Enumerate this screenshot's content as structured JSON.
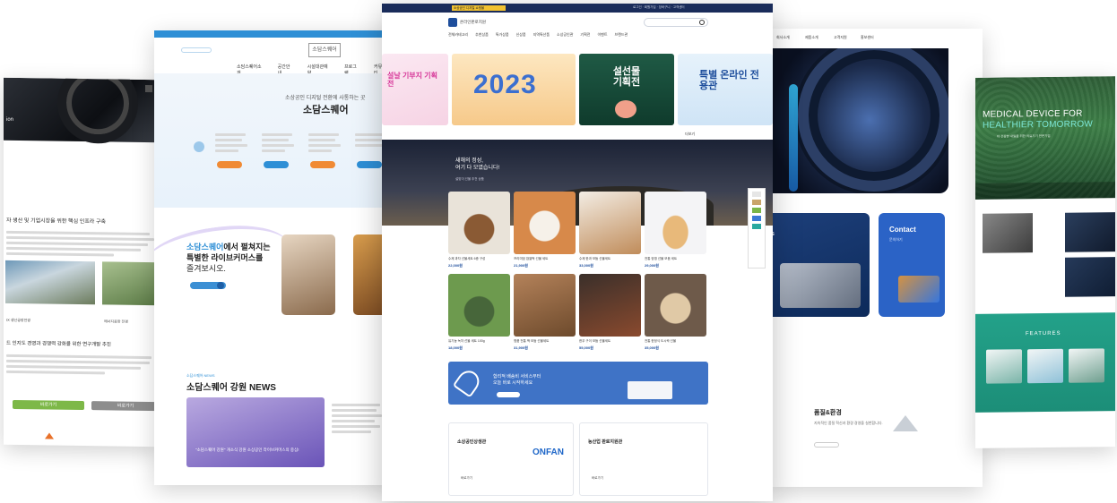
{
  "mock1": {
    "hero_name": "ion",
    "section_title": "자 생산 및 기업시장을 위한 핵심 인프라 구축",
    "caption_left": "IX 생산공장전경",
    "caption_right": "에너지공장 전경",
    "section2_title": "드 인지도 경영과 경쟁력 강화를 위한 연구개발 추진",
    "green_button": "바로가기",
    "gray_button": "바로가기"
  },
  "mock2": {
    "logo": "소담스퀘어",
    "nav": [
      "소담스퀘어소개",
      "공간안내",
      "시설대관예약",
      "프로그램",
      "커뮤니티"
    ],
    "hero_sub": "소상공인 디지털 전환에 사통하는 곳",
    "hero_title": "소담스퀘어",
    "lb_title_blue": "소담스퀘어",
    "lb_title_rest": "에서 펼쳐지는",
    "lb_title_line2": "특별한 라이브커머스를",
    "lb_title_line3": "즐겨보시오.",
    "news_sub": "소담스퀘어 NEWS",
    "news_title": "소담스퀘어 강원 NEWS",
    "news_caption": "\"소담스퀘어 강원\" 개소식 강원 소상공인 라이브커머스의 중심!"
  },
  "mock3": {
    "util_badge": "소상공인 디지털 쇼핑몰",
    "util_links": "로그인 · 회원가입 · 장바구니 · 고객센터",
    "logo_text": "온라인판로지원",
    "gnb": [
      "전체카테고리",
      "추천상품",
      "특가상품",
      "신상품",
      "지역특산품",
      "소상공인관",
      "기획전",
      "이벤트",
      "브랜드관"
    ],
    "banner_left": "설날 기부지 기획전",
    "banner_2023": "2023",
    "banner_sul": "설선물 기획전",
    "banner_right": "특별 온라인 전용관",
    "banner_more": "더보기",
    "hero_title_1": "새해의 정성,",
    "hero_title_2": "여기 다 모였습니다!",
    "hero_sub": "설맞이 선물 추천 상품",
    "products": [
      {
        "caption": "수제 과자 선물세트 6종 구성",
        "price": "22,000원"
      },
      {
        "caption": "프리미엄 찹쌀떡 선물 세트",
        "price": "21,900원"
      },
      {
        "caption": "수제 한과 모둠 선물세트",
        "price": "33,000원"
      },
      {
        "caption": "전통 양갱 선물 모음 세트",
        "price": "29,000원"
      },
      {
        "caption": "유기농 녹차 선물 세트 100g",
        "price": "18,000원"
      },
      {
        "caption": "명품 전통 떡 모둠 선물세트",
        "price": "31,900원"
      },
      {
        "caption": "한우 구이 모둠 선물세트",
        "price": "55,000원"
      },
      {
        "caption": "전통 한정식 도시락 선물",
        "price": "35,000원"
      }
    ],
    "promo_text_1": "합리적 배송비 서비스부터",
    "promo_text_2": "오늘 바로 시작하세요",
    "promo_button": "바로가기",
    "box1_title": "소상공인상생관",
    "box1_link": "바로가기",
    "onfan": "ONFAN",
    "box2_title": "농산업 판로지원관",
    "box2_link": "바로가기"
  },
  "mock4": {
    "nav": [
      "회사소개",
      "제품소개",
      "고객지원",
      "홍보센터"
    ],
    "card_title": "s",
    "contact_title": "Contact",
    "contact_sub": "문의하기",
    "quality_title": "품질&환경",
    "quality_text": "지속적인 품질 혁신과 환경 경영을 실천합니다.",
    "quality_button": "자세히보기"
  },
  "mock5": {
    "hero_line1": "MEDICAL DEVICE FOR",
    "hero_line2": "HEALTHIER TOMORROW",
    "hero_sub": "더 건강한 내일을 위한 의료기기 전문기업",
    "features_title": "FEATURES"
  }
}
